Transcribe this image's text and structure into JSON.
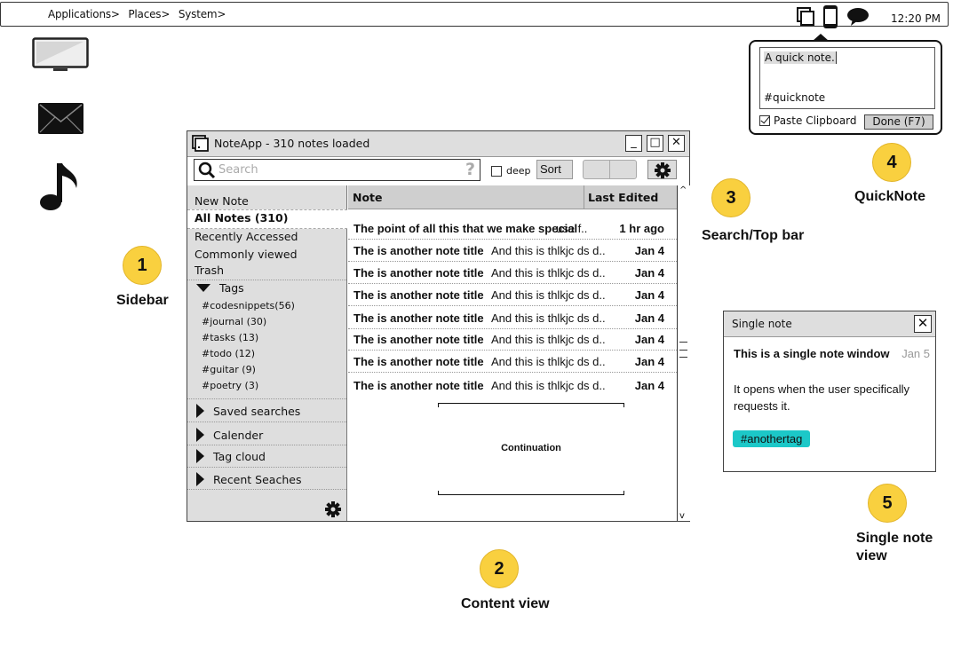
{
  "topbar": {
    "menus": [
      "Applications>",
      "Places>",
      "System>"
    ],
    "tray_icons": [
      "windows-icon",
      "phone-icon",
      "chat-bubble-icon"
    ],
    "clock": "12:20 PM"
  },
  "desktop_icons": [
    "monitor-icon",
    "mail-icon",
    "music-note-icon"
  ],
  "quicknote": {
    "text_line1": "A quick note.",
    "text_line2": "#quicknote",
    "paste_clipboard_label": "Paste Clipboard",
    "paste_clipboard_checked": true,
    "done_label": "Done (F7)"
  },
  "window": {
    "title": "NoteApp - 310 notes loaded",
    "controls": [
      "_",
      "□",
      "✕"
    ],
    "toolbar": {
      "search_placeholder": "Search",
      "help": "?",
      "deep_label": "deep",
      "deep_checked": false,
      "sort_label": "Sort"
    },
    "sidebar": {
      "items": [
        "New Note",
        "All Notes (310)",
        "Recently Accessed",
        "Commonly viewed",
        "Trash"
      ],
      "selected": "All Notes (310)",
      "tags_label": "Tags",
      "tags": [
        "#codesnippets(56)",
        "#journal (30)",
        "#tasks (13)",
        "#todo (12)",
        "#guitar (9)",
        "#poetry (3)"
      ],
      "sections": [
        "Saved searches",
        "Calender",
        "Tag cloud",
        "Recent Seaches"
      ]
    },
    "content": {
      "columns": [
        "Note",
        "Last Edited"
      ],
      "rows": [
        {
          "title": "The point of all this that we make special",
          "snippet": "use f..",
          "date": "1 hr ago"
        },
        {
          "title": "The is another note title",
          "snippet": "And this is thlkjc ds d..",
          "date": "Jan 4"
        },
        {
          "title": "The is another note title",
          "snippet": "And this is thlkjc ds d..",
          "date": "Jan 4"
        },
        {
          "title": "The is another note title",
          "snippet": "And this is thlkjc ds d..",
          "date": "Jan 4"
        },
        {
          "title": "The is another note title",
          "snippet": "And this is thlkjc ds d..",
          "date": "Jan 4"
        },
        {
          "title": "The is another note title",
          "snippet": "And this is thlkjc ds d..",
          "date": "Jan 4"
        },
        {
          "title": "The is another note title",
          "snippet": "And this is thlkjc ds d..",
          "date": "Jan 4"
        },
        {
          "title": "The is another note title",
          "snippet": "And this is thlkjc ds d..",
          "date": "Jan 4"
        }
      ],
      "continuation_label": "Continuation"
    }
  },
  "single_note": {
    "window_title": "Single note",
    "title": "This is a single note window",
    "date": "Jan 5",
    "body": "It opens when the user specifically requests it.",
    "tag": "#anothertag",
    "tag_color": "#1cc8c8"
  },
  "annotations": [
    {
      "number": "1",
      "label": "Sidebar"
    },
    {
      "number": "2",
      "label": "Content view"
    },
    {
      "number": "3",
      "label": "Search/Top bar"
    },
    {
      "number": "4",
      "label": "QuickNote"
    },
    {
      "number": "5",
      "label": "Single note view"
    }
  ],
  "colors": {
    "badge": "#f9d03f",
    "panel_gray": "#dedede",
    "tag_teal": "#1cc8c8"
  }
}
